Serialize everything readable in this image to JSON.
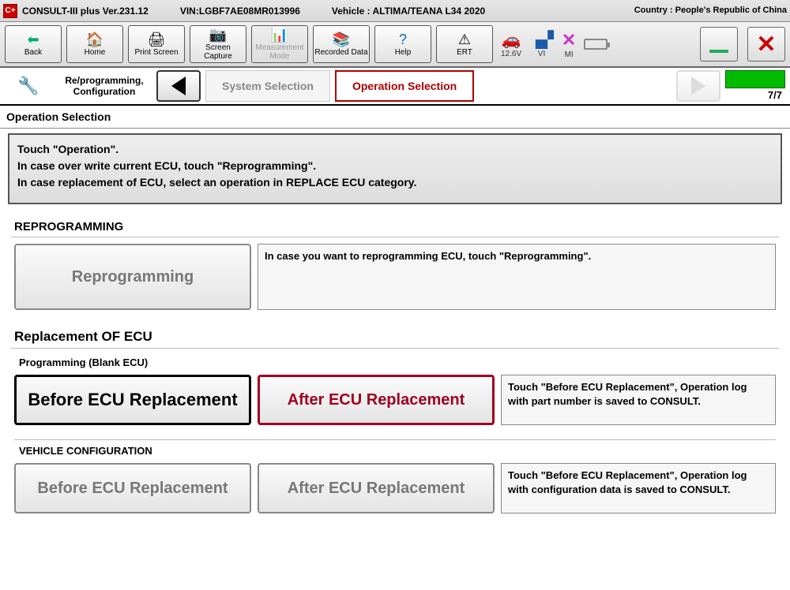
{
  "header": {
    "app_title": "CONSULT-III plus  Ver.231.12",
    "vin_label": "VIN:LGBF7AE08MR013996",
    "vehicle_label": "Vehicle : ALTIMA/TEANA L34 2020",
    "country_label": "Country : People's Republic of China"
  },
  "toolbar": {
    "back": "Back",
    "home": "Home",
    "print": "Print Screen",
    "capture": "Screen Capture",
    "measurement": "Measurement Mode",
    "recorded": "Recorded Data",
    "help": "Help",
    "ert": "ERT"
  },
  "status": {
    "voltage": "12.6V",
    "vi": "VI",
    "mi": "MI"
  },
  "breadcrumb": {
    "mode": "Re/programming, Configuration",
    "step_prev": "System Selection",
    "step_current": "Operation Selection",
    "progress": "7/7"
  },
  "section_title": "Operation Selection",
  "instruction": {
    "line1": "Touch \"Operation\".",
    "line2": "In case over write current ECU, touch \"Reprogramming\".",
    "line3": "In case replacement of ECU, select an operation in REPLACE ECU category."
  },
  "reprog": {
    "title": "REPROGRAMMING",
    "button": "Reprogramming",
    "desc": "In case you want to reprogramming ECU, touch \"Reprogramming\"."
  },
  "replace": {
    "title": "Replacement OF ECU",
    "sub1": "Programming (Blank ECU)",
    "before": "Before ECU Replacement",
    "after": "After ECU Replacement",
    "desc1": "Touch \"Before ECU Replacement\", Operation log with part number is saved to CONSULT.",
    "sub2": "VEHICLE CONFIGURATION",
    "before2": "Before ECU Replacement",
    "after2": "After ECU Replacement",
    "desc2": "Touch \"Before ECU Replacement\", Operation log with configuration data is saved to CONSULT."
  }
}
